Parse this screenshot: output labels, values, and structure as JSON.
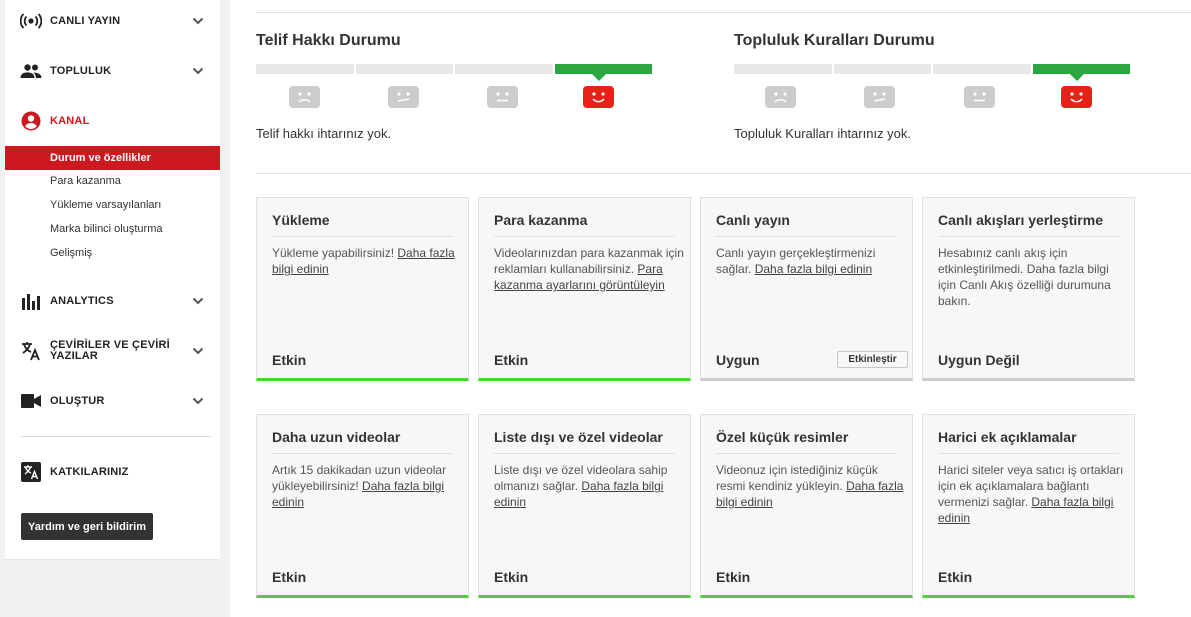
{
  "sidebar": {
    "items": [
      {
        "label": "CANLI YAYIN",
        "icon": "live-broadcast-icon"
      },
      {
        "label": "TOPLULUK",
        "icon": "people-icon"
      },
      {
        "label": "KANAL",
        "icon": "account-circle-icon"
      },
      {
        "label": "ANALYTICS",
        "icon": "bar-chart-icon"
      },
      {
        "label": "ÇEVİRİLER VE ÇEVİRİ",
        "label2": "YAZILAR",
        "icon": "translate-icon"
      },
      {
        "label": "OLUŞTUR",
        "icon": "video-camera-icon"
      },
      {
        "label": "KATKILARINIZ",
        "icon": "translate-contributions-icon"
      }
    ],
    "channel_sub": [
      "Durum ve özellikler",
      "Para kazanma",
      "Yükleme varsayılanları",
      "Marka bilinci oluşturma",
      "Gelişmiş"
    ],
    "help_button": "Yardım ve geri bildirim"
  },
  "copyright": {
    "title": "Telif Hakkı Durumu",
    "text": "Telif hakkı ihtarınız yok."
  },
  "community": {
    "title": "Topluluk Kuralları Durumu",
    "text": "Topluluk Kuralları ihtarınız yok."
  },
  "colors": {
    "accent": "#cc181e",
    "green": "#2ba640",
    "ok_bar": "#4cd137"
  },
  "cards": [
    {
      "title": "Yükleme",
      "body": "Yükleme yapabilirsiniz! ",
      "link": "Daha fazla bilgi edinin",
      "status": "Etkin"
    },
    {
      "title": "Para kazanma",
      "body": "Videolarınızdan para kazanmak için reklamları kullanabilirsiniz. ",
      "link": "Para kazanma ayarlarını görüntüleyin",
      "status": "Etkin"
    },
    {
      "title": "Canlı yayın",
      "body": "Canlı yayın gerçekleştirmenizi sağlar. ",
      "link": "Daha fazla bilgi edinin",
      "status": "Uygun",
      "button": "Etkinleştir"
    },
    {
      "title": "Canlı akışları yerleştirme",
      "body": "Hesabınız canlı akış için etkinleştirilmedi. Daha fazla bilgi için Canlı Akış özelliği durumuna bakın.",
      "link": "",
      "status": "Uygun Değil"
    },
    {
      "title": "Daha uzun videolar",
      "body": "Artık 15 dakikadan uzun videolar yükleyebilirsiniz! ",
      "link": "Daha fazla bilgi edinin",
      "status": "Etkin"
    },
    {
      "title": "Liste dışı ve özel videolar",
      "body": "Liste dışı ve özel videolara sahip olmanızı sağlar. ",
      "link": "Daha fazla bilgi edinin",
      "status": "Etkin"
    },
    {
      "title": "Özel küçük resimler",
      "body": "Videonuz için istediğiniz küçük resmi kendiniz yükleyin. ",
      "link": "Daha fazla bilgi edinin",
      "status": "Etkin"
    },
    {
      "title": "Harici ek açıklamalar",
      "body": "Harici siteler veya satıcı iş ortakları için ek açıklamalara bağlantı vermenizi sağlar. ",
      "link": "Daha fazla bilgi edinin",
      "status": "Etkin"
    }
  ]
}
